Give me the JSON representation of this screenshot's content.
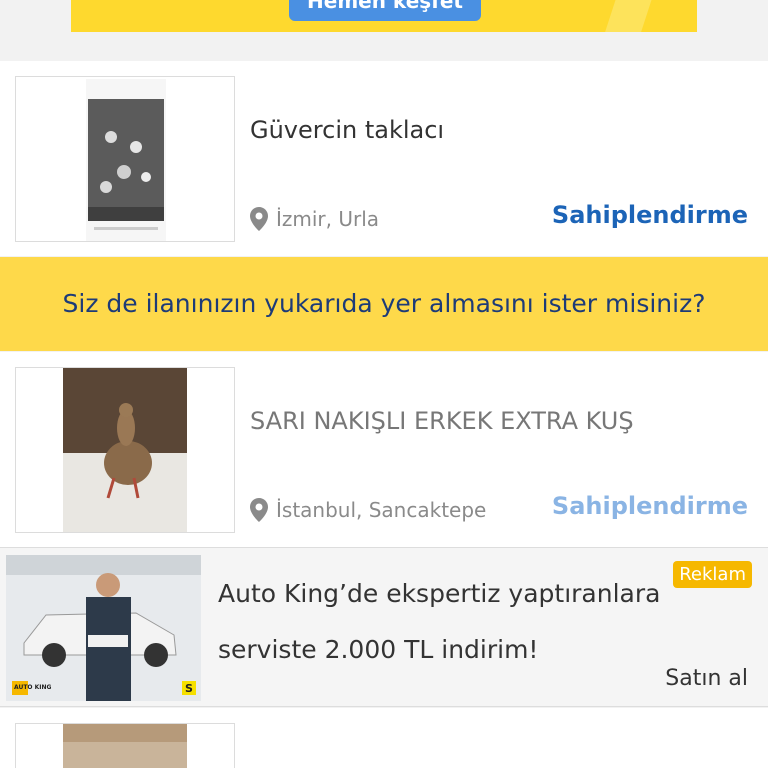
{
  "top_banner": {
    "button_label": "Hemen keşfet"
  },
  "listings": [
    {
      "title": "Güvercin taklacı",
      "location": "İzmir, Urla",
      "tag": "Sahiplendirme"
    },
    {
      "title": "SARI NAKIŞLI ERKEK EXTRA KUŞ",
      "location": "İstanbul, Sancaktepe",
      "tag": "Sahiplendirme"
    }
  ],
  "promo": {
    "text": "Siz de ilanınızın yukarıda yer almasını ister misiniz?"
  },
  "ad": {
    "line1": "Auto King’de ekspertiz yaptıranlara",
    "line2": "serviste 2.000 TL indirim!",
    "badge": "Reklam",
    "action": "Satın al",
    "logo_text": "AUTO KING",
    "corner_mark": "S"
  },
  "colors": {
    "accent_blue": "#1c64b7",
    "faded_blue": "#8ab4e4",
    "yellow": "#fed94a"
  }
}
